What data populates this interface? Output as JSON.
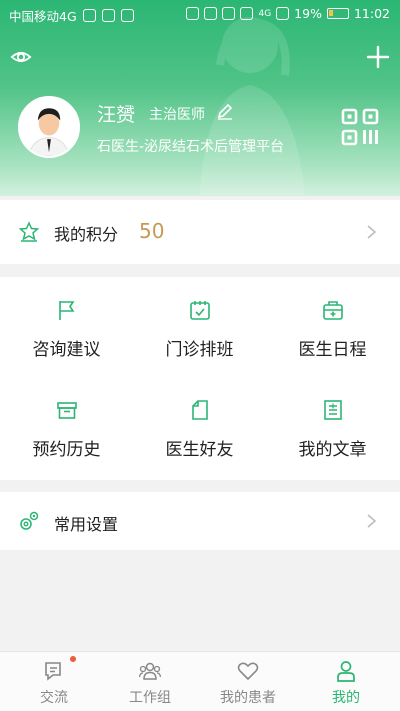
{
  "status_bar": {
    "carrier": "中国移动4G",
    "signal": "4G",
    "battery": "19%",
    "time": "11:02"
  },
  "profile": {
    "name": "汪赟",
    "title": "主治医师",
    "platform": "石医生-泌尿结石术后管理平台"
  },
  "points": {
    "label": "我的积分",
    "value": "50"
  },
  "grid": [
    {
      "label": "咨询建议",
      "icon": "flag-icon"
    },
    {
      "label": "门诊排班",
      "icon": "calendar-check-icon"
    },
    {
      "label": "医生日程",
      "icon": "medical-box-icon"
    },
    {
      "label": "预约历史",
      "icon": "archive-box-icon"
    },
    {
      "label": "医生好友",
      "icon": "document-icon"
    },
    {
      "label": "我的文章",
      "icon": "article-icon"
    }
  ],
  "settings": {
    "label": "常用设置"
  },
  "tabs": [
    {
      "label": "交流",
      "icon": "chat-icon",
      "has_dot": true
    },
    {
      "label": "工作组",
      "icon": "group-icon"
    },
    {
      "label": "我的患者",
      "icon": "heart-icon"
    },
    {
      "label": "我的",
      "icon": "person-icon",
      "active": true
    }
  ],
  "colors": {
    "primary": "#2bb673",
    "points_value": "#c69a55",
    "badge": "#f05a3e"
  }
}
